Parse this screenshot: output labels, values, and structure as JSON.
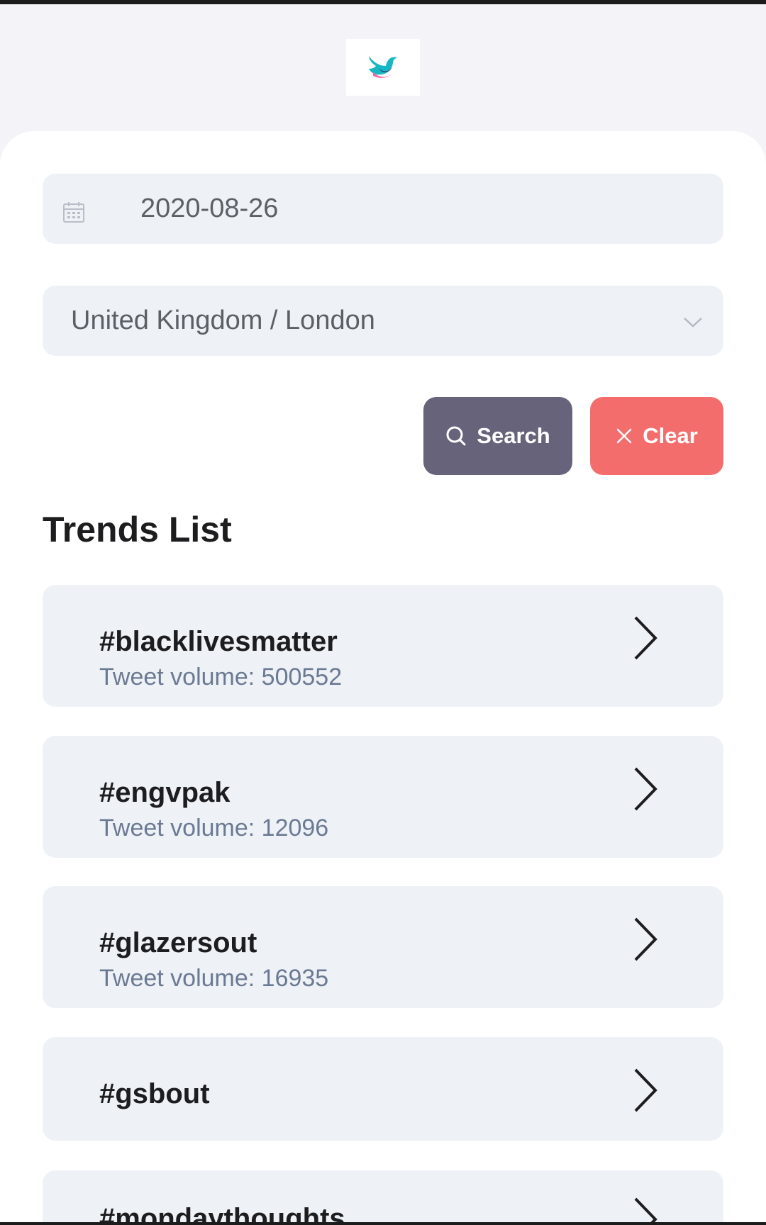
{
  "form": {
    "date_value": "2020-08-26",
    "location_value": "United Kingdom / London"
  },
  "actions": {
    "search_label": "Search",
    "clear_label": "Clear"
  },
  "trends": {
    "title": "Trends List",
    "items": [
      {
        "name": "#blacklivesmatter",
        "volume": "Tweet volume: 500552"
      },
      {
        "name": "#engvpak",
        "volume": "Tweet volume: 12096"
      },
      {
        "name": "#glazersout",
        "volume": "Tweet volume: 16935"
      },
      {
        "name": "#gsbout",
        "volume": ""
      },
      {
        "name": "#mondaythoughts",
        "volume": ""
      }
    ]
  },
  "icons": {
    "logo": "bird-logo-icon",
    "date": "calendar-icon",
    "location": "chevron-down-icon",
    "search": "search-icon",
    "clear": "close-icon",
    "row": "chevron-right-icon"
  },
  "colors": {
    "search_button": "#66637a",
    "clear_button": "#f46d6d",
    "field_bg": "#eef1f5",
    "page_bg": "#f4f4f8"
  }
}
